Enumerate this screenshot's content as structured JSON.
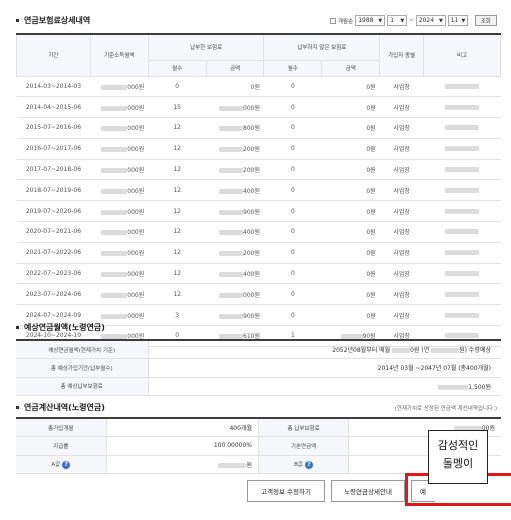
{
  "section1": {
    "title": "연금보험료상세내역",
    "period": {
      "mode_label": "개월순",
      "start_year": "1988",
      "start_month": "1",
      "separator": "~",
      "end_year": "2024",
      "end_month": "11",
      "search_label": "조회"
    },
    "headers": {
      "period": "기간",
      "base_income": "기준소득월액",
      "paid": "납부한 보험료",
      "unpaid": "납부하지 않은 보험료",
      "months": "월수",
      "amount": "금액",
      "months2": "월수",
      "amount2": "금액",
      "subscriber_type": "가입자 종별",
      "remarks": "비고"
    },
    "rows": [
      {
        "period": "2014-03~2014-03",
        "income": "000원",
        "paid_months": "0",
        "paid_amount": "0원",
        "unpaid_months": "0",
        "unpaid_amount": "0원",
        "type": "사업장"
      },
      {
        "period": "2014-04~2015-06",
        "income": "000원",
        "paid_months": "15",
        "paid_amount": "000원",
        "unpaid_months": "0",
        "unpaid_amount": "0원",
        "type": "사업장"
      },
      {
        "period": "2015-07~2016-06",
        "income": "000원",
        "paid_months": "12",
        "paid_amount": "800원",
        "unpaid_months": "0",
        "unpaid_amount": "0원",
        "type": "사업장"
      },
      {
        "period": "2016-07~2017-06",
        "income": "000원",
        "paid_months": "12",
        "paid_amount": "200원",
        "unpaid_months": "0",
        "unpaid_amount": "0원",
        "type": "사업장"
      },
      {
        "period": "2017-07~2018-06",
        "income": "000원",
        "paid_months": "12",
        "paid_amount": "200원",
        "unpaid_months": "0",
        "unpaid_amount": "0원",
        "type": "사업장"
      },
      {
        "period": "2018-07~2019-06",
        "income": "000원",
        "paid_months": "12",
        "paid_amount": "400원",
        "unpaid_months": "0",
        "unpaid_amount": "0원",
        "type": "사업장"
      },
      {
        "period": "2019-07~2020-06",
        "income": "000원",
        "paid_months": "12",
        "paid_amount": "900원",
        "unpaid_months": "0",
        "unpaid_amount": "0원",
        "type": "사업장"
      },
      {
        "period": "2020-07~2021-06",
        "income": "000원",
        "paid_months": "12",
        "paid_amount": "400원",
        "unpaid_months": "0",
        "unpaid_amount": "0원",
        "type": "사업장"
      },
      {
        "period": "2021-07~2022-06",
        "income": "000원",
        "paid_months": "12",
        "paid_amount": "200원",
        "unpaid_months": "0",
        "unpaid_amount": "0원",
        "type": "사업장"
      },
      {
        "period": "2022-07~2023-06",
        "income": "000원",
        "paid_months": "12",
        "paid_amount": "400원",
        "unpaid_months": "0",
        "unpaid_amount": "0원",
        "type": "사업장"
      },
      {
        "period": "2023-07~2024-06",
        "income": "000원",
        "paid_months": "12",
        "paid_amount": "000원",
        "unpaid_months": "0",
        "unpaid_amount": "0원",
        "type": "사업장"
      },
      {
        "period": "2024-07~2024-09",
        "income": "000원",
        "paid_months": "3",
        "paid_amount": "900원",
        "unpaid_months": "0",
        "unpaid_amount": "0원",
        "type": "사업장"
      },
      {
        "period": "2024-10~2024-10",
        "income": "000원",
        "paid_months": "0",
        "paid_amount": "610원",
        "unpaid_months": "1",
        "unpaid_amount": "90원",
        "type": "사업장"
      }
    ]
  },
  "section2": {
    "title": "예상연금월액(노령연금)",
    "rows": [
      {
        "label": "예상연금월액(현재가치 기준)",
        "value_pre": "2052년08월부터 매월",
        "value_mid": "0원 (연",
        "value_post": "원) 수령예상"
      },
      {
        "label": "총 예상가입기간(납부월수)",
        "value_pre": "2014년 03월 ~2047년 07월 (총400개월)",
        "value_mid": "",
        "value_post": ""
      },
      {
        "label": "총 예상납부보험료",
        "value_pre": "",
        "value_mid": "",
        "value_post": "1,500원"
      }
    ]
  },
  "section3": {
    "title": "연금계산내역(노령연금)",
    "note": "(현재가치로 산정된 연금액 계산내역입니다.)",
    "rows": [
      {
        "l1": "총가입개월",
        "v1": "400개월",
        "l2": "총 납부보험료",
        "v2": "00원"
      },
      {
        "l1": "지급률",
        "v1": "100.00000%",
        "l2": "기본연금액",
        "v2": ""
      },
      {
        "l1": "A값",
        "v1": "원",
        "l2": "B값",
        "v2": ""
      }
    ]
  },
  "buttons": {
    "edit_info": "고객정보 수정하기",
    "pension_guide": "노령연금상세안내",
    "third": "예"
  },
  "sticker": {
    "line1": "감성적인",
    "line2": "돌멩이"
  },
  "colors": {
    "header_border": "#3d3d3d",
    "header_bg": "#f6f7fb",
    "help_icon": "#3b6fd0",
    "highlight": "#e01818"
  }
}
